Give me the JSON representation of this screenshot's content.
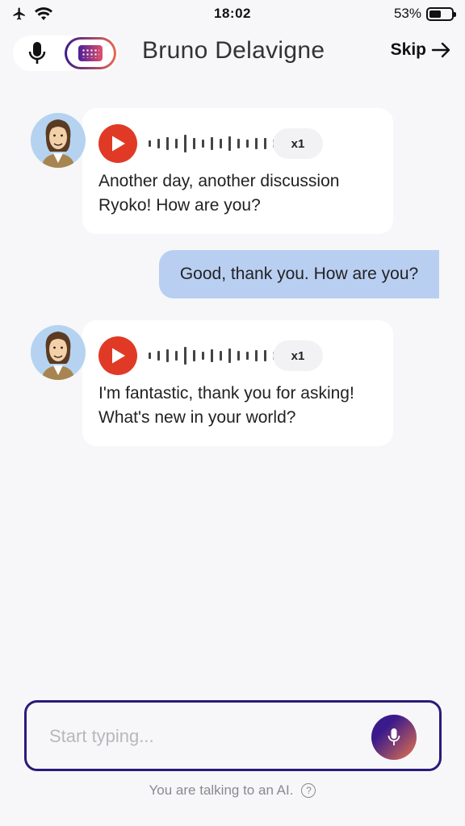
{
  "status_bar": {
    "time": "18:02",
    "battery_percent": "53%",
    "battery_level": 0.53,
    "icons": [
      "airplane-icon",
      "wifi-icon",
      "battery-icon"
    ]
  },
  "header": {
    "contact_name": "Bruno Delavigne",
    "skip_label": "Skip",
    "mode_icons": [
      "microphone-icon",
      "keyboard-icon"
    ],
    "active_mode": "keyboard"
  },
  "messages": [
    {
      "sender": "ai",
      "speed": "x1",
      "text_line1": "Another day, another discussion",
      "text_line2": "Ryoko! How are you?"
    },
    {
      "sender": "user",
      "text": "Good, thank you. How are you?"
    },
    {
      "sender": "ai",
      "speed": "x1",
      "text_line1": "I'm fantastic, thank you for asking!",
      "text_line2": "What's new in your world?"
    }
  ],
  "input": {
    "placeholder": "Start typing...",
    "value": ""
  },
  "footer": {
    "note": "You are talking to an AI.",
    "help_glyph": "?"
  },
  "colors": {
    "background": "#f7f7f9",
    "play_button": "#e03a26",
    "user_bubble": "#b9cff2",
    "accent_start": "#3b1a8c",
    "accent_end": "#e8744c",
    "input_border": "#2b1a7a"
  }
}
